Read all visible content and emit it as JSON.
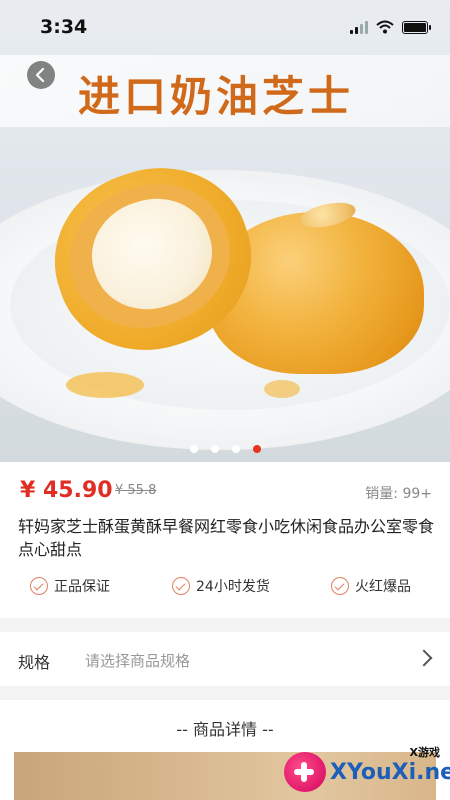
{
  "status_bar": {
    "time": "3:34"
  },
  "banner": {
    "title": "进口奶油芝士"
  },
  "carousel": {
    "count": 4,
    "active_index": 3
  },
  "product": {
    "price": "¥ 45.90",
    "original_price": "¥ 55.8",
    "sales": "销量: 99+",
    "title": "轩妈家芝士酥蛋黄酥早餐网红零食小吃休闲食品办公室零食点心甜点"
  },
  "guarantees": [
    "正品保证",
    "24小时发货",
    "火红爆品"
  ],
  "spec": {
    "label": "规格",
    "placeholder": "请选择商品规格"
  },
  "details": {
    "header": "-- 商品详情 --"
  },
  "watermark": {
    "cn": "X游戏",
    "en": "XYouXi.net"
  },
  "colors": {
    "accent": "#e02e24",
    "banner_text": "#d06a1a"
  }
}
